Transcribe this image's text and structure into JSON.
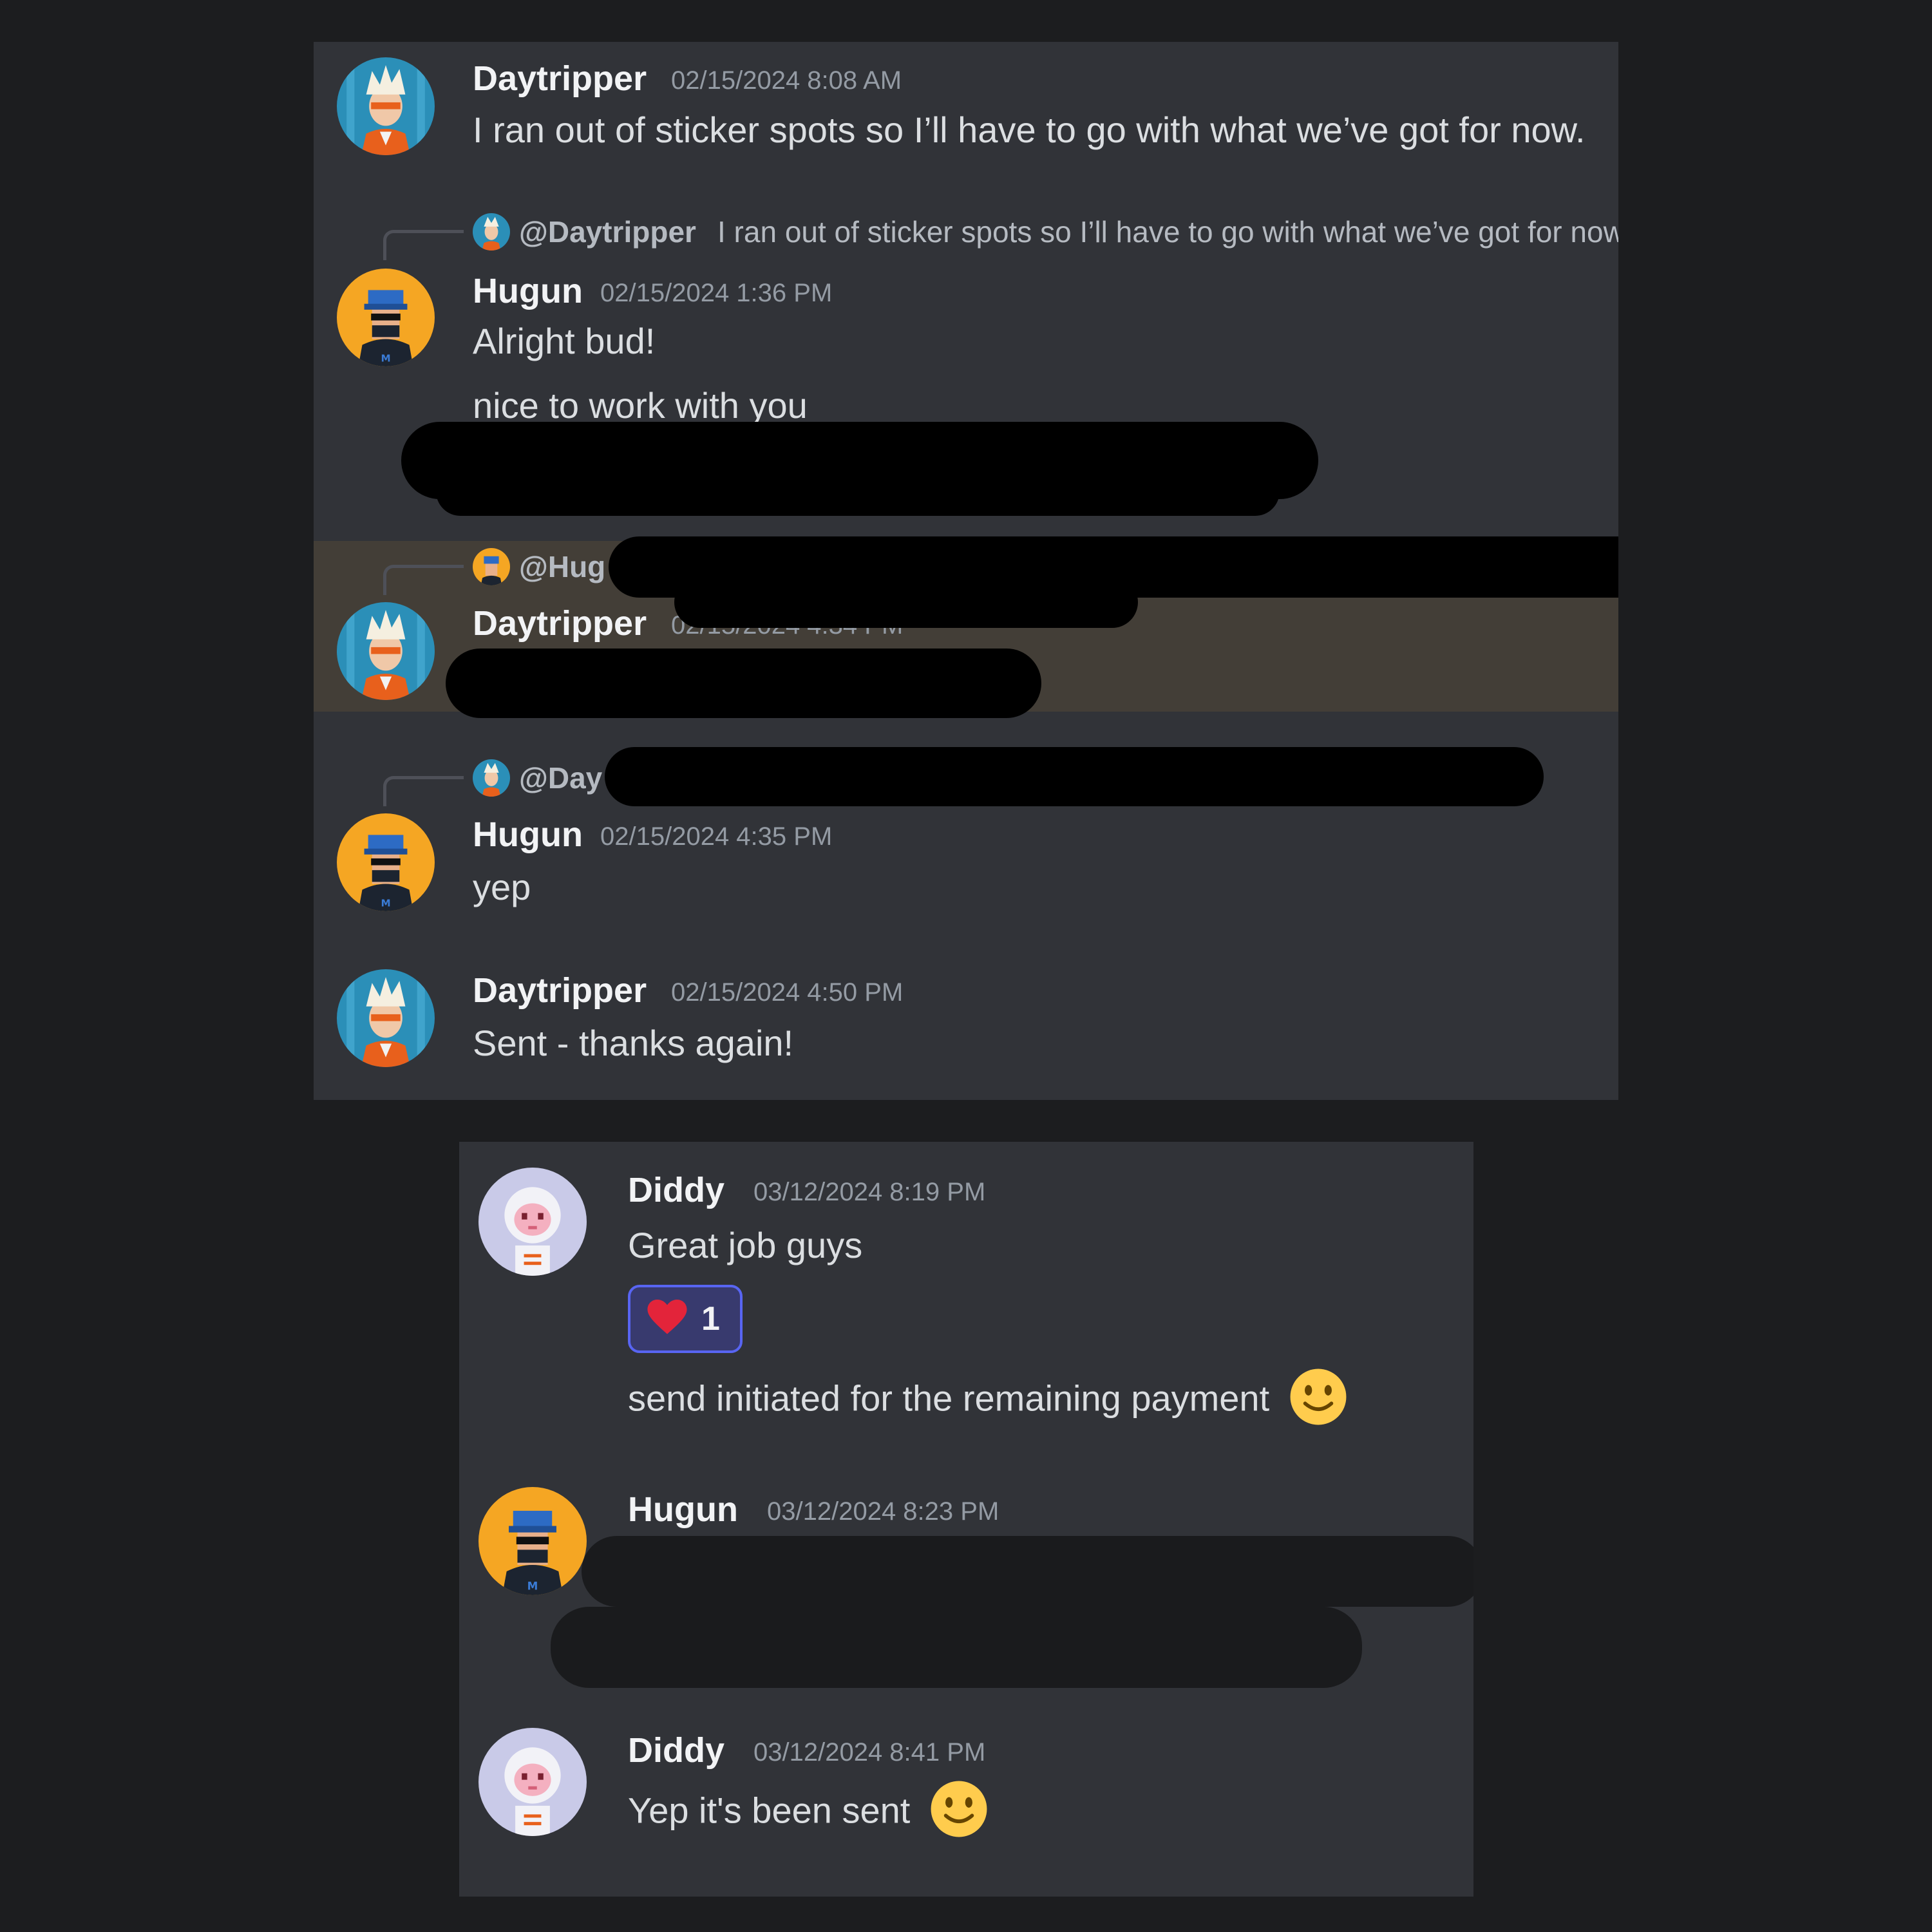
{
  "panel1": {
    "messages": [
      {
        "author": "Daytripper",
        "timestamp": "02/15/2024 8:08 AM",
        "text": "I ran out of sticker spots so I’ll have to go with what we’ve got for now.",
        "avatar": "daytripper-avatar"
      },
      {
        "reply": {
          "author": "@Daytripper",
          "text": "I ran out of sticker spots so I’ll have to go with what we’ve got for now."
        },
        "author": "Hugun",
        "timestamp": "02/15/2024 1:36 PM",
        "lines": [
          "Alright bud!",
          "nice to work with you"
        ],
        "avatar": "hugun-avatar"
      },
      {
        "reply": {
          "author": "@Hug"
        },
        "author": "Daytripper",
        "timestamp": "02/15/2024 4:34 PM",
        "highlighted": true,
        "avatar": "daytripper-avatar"
      },
      {
        "reply": {
          "author": "@Day"
        },
        "author": "Hugun",
        "timestamp": "02/15/2024 4:35 PM",
        "text": "yep",
        "avatar": "hugun-avatar"
      },
      {
        "author": "Daytripper",
        "timestamp": "02/15/2024 4:50 PM",
        "text": "Sent - thanks again!",
        "avatar": "daytripper-avatar"
      }
    ]
  },
  "panel2": {
    "messages": [
      {
        "author": "Diddy",
        "timestamp": "03/12/2024 8:19 PM",
        "text": "Great job guys",
        "reaction": {
          "emoji": "heart-icon",
          "count": "1"
        },
        "text2": "send initiated for the remaining payment",
        "avatar": "diddy-avatar"
      },
      {
        "author": "Hugun",
        "timestamp": "03/12/2024 8:23 PM",
        "avatar": "hugun-avatar"
      },
      {
        "author": "Diddy",
        "timestamp": "03/12/2024 8:41 PM",
        "text": "Yep it's been sent",
        "avatar": "diddy-avatar"
      }
    ]
  },
  "colors": {
    "panel": "#313338",
    "background": "#1c1d1f",
    "highlight": "#433e37",
    "reaction_bg": "#383a6e",
    "reaction_border": "#5865f2",
    "hugun_avatar": "#f5a623",
    "daytripper_avatar": "#2b8fb8",
    "diddy_avatar": "#c9cae8"
  }
}
